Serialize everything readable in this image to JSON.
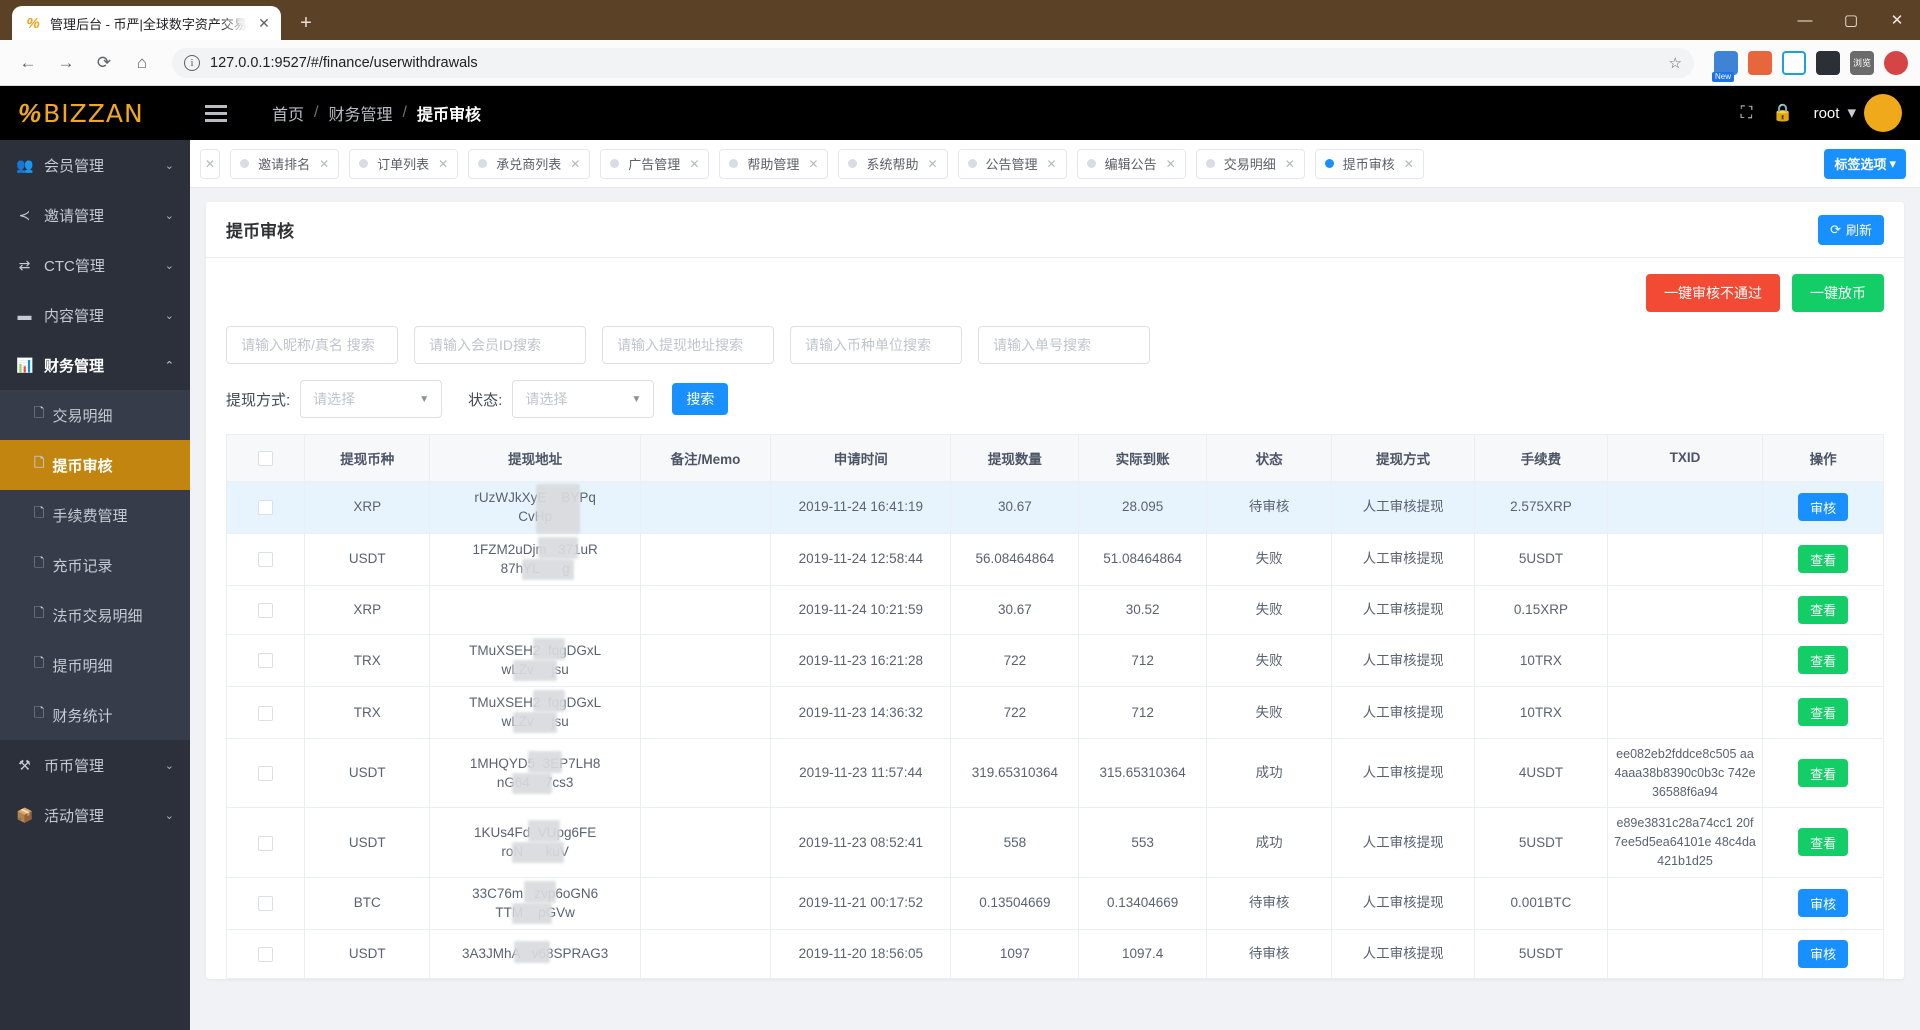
{
  "browser": {
    "tab_title": "管理后台 - 币严|全球数字资产交易",
    "tab_close": "✕",
    "new_tab": "+",
    "back": "←",
    "forward": "→",
    "reload": "⟳",
    "home": "⌂",
    "url": "127.0.0.1:9527/#/finance/userwithdrawals",
    "info_icon": "i",
    "star": "☆",
    "ext_new_badge": "New",
    "ext_labels": [
      "",
      "",
      "",
      "",
      "浏览",
      ""
    ],
    "minimize": "—",
    "maximize": "▢",
    "close": "✕"
  },
  "topbar": {
    "logo_mark": "%",
    "logo_text": "BIZZAN",
    "breadcrumbs": [
      "首页",
      "财务管理",
      "提币审核"
    ],
    "separator": "/",
    "fullscreen_icon": "⛶",
    "lock_icon": "🔒",
    "user_name": "root",
    "user_caret": "▾"
  },
  "sidebar": {
    "items": [
      {
        "label": "会员管理",
        "icon": "👥",
        "arrow": "⌄",
        "open": false
      },
      {
        "label": "邀请管理",
        "icon": "≺",
        "arrow": "⌄",
        "open": false
      },
      {
        "label": "CTC管理",
        "icon": "⇄",
        "arrow": "⌄",
        "open": false
      },
      {
        "label": "内容管理",
        "icon": "▬",
        "arrow": "⌄",
        "open": false
      },
      {
        "label": "财务管理",
        "icon": "📊",
        "arrow": "⌃",
        "open": true
      },
      {
        "label": "币币管理",
        "icon": "⚒",
        "arrow": "⌄",
        "open": false
      },
      {
        "label": "活动管理",
        "icon": "📦",
        "arrow": "⌄",
        "open": false
      }
    ],
    "submenu": [
      {
        "label": "交易明细",
        "icon": "🗋",
        "active": false
      },
      {
        "label": "提币审核",
        "icon": "🗋",
        "active": true
      },
      {
        "label": "手续费管理",
        "icon": "🗋",
        "active": false
      },
      {
        "label": "充币记录",
        "icon": "🗋",
        "active": false
      },
      {
        "label": "法币交易明细",
        "icon": "🗋",
        "active": false
      },
      {
        "label": "提币明细",
        "icon": "🗋",
        "active": false
      },
      {
        "label": "财务统计",
        "icon": "🗋",
        "active": false
      }
    ]
  },
  "tagbar": {
    "tags": [
      {
        "label": "邀请排名",
        "active": false
      },
      {
        "label": "订单列表",
        "active": false
      },
      {
        "label": "承兑商列表",
        "active": false
      },
      {
        "label": "广告管理",
        "active": false
      },
      {
        "label": "帮助管理",
        "active": false
      },
      {
        "label": "系统帮助",
        "active": false
      },
      {
        "label": "公告管理",
        "active": false
      },
      {
        "label": "编辑公告",
        "active": false
      },
      {
        "label": "交易明细",
        "active": false
      },
      {
        "label": "提币审核",
        "active": true
      }
    ],
    "close_glyph": "✕",
    "options_label": "标签选项",
    "options_caret": "▾"
  },
  "page": {
    "title": "提币审核",
    "refresh_label": "刷新",
    "refresh_icon": "⟳",
    "bulk_reject_label": "一键审核不通过",
    "bulk_release_label": "一键放币",
    "filters": [
      {
        "placeholder": "请输入昵称/真名 搜索",
        "value": ""
      },
      {
        "placeholder": "请输入会员ID搜索",
        "value": ""
      },
      {
        "placeholder": "请输入提现地址搜索",
        "value": ""
      },
      {
        "placeholder": "请输入币种单位搜索",
        "value": ""
      },
      {
        "placeholder": "请输入单号搜索",
        "value": ""
      }
    ],
    "selects": [
      {
        "label": "提现方式:",
        "value": "请选择",
        "caret": "▼"
      },
      {
        "label": "状态:",
        "value": "请选择",
        "caret": "▼"
      }
    ],
    "search_label": "搜索"
  },
  "table": {
    "columns": [
      "",
      "提现币种",
      "提现地址",
      "备注/Memo",
      "申请时间",
      "提现数量",
      "实际到账",
      "状态",
      "提现方式",
      "手续费",
      "TXID",
      "操作"
    ],
    "rows": [
      {
        "coin": "XRP",
        "address_1": "rUzWJkXyE",
        "address_2": "BYPq",
        "address_3": "CvHp",
        "memo": "",
        "time": "2019-11-24 16:41:19",
        "amount": "30.67",
        "actual": "28.095",
        "status": "待审核",
        "method": "人工审核提现",
        "fee": "2.575XRP",
        "txid": "",
        "action": "审核",
        "action_type": "approve",
        "highlight": true
      },
      {
        "coin": "USDT",
        "address_1": "1FZM2uDjm",
        "address_2": "371uR",
        "address_3": "87hYL",
        "address_4": "g",
        "memo": "",
        "time": "2019-11-24 12:58:44",
        "amount": "56.08464864",
        "actual": "51.08464864",
        "status": "失败",
        "method": "人工审核提现",
        "fee": "5USDT",
        "txid": "",
        "action": "查看",
        "action_type": "view",
        "highlight": false
      },
      {
        "coin": "XRP",
        "address_1": "",
        "address_2": "",
        "address_3": "",
        "memo": "",
        "time": "2019-11-24 10:21:59",
        "amount": "30.67",
        "actual": "30.52",
        "status": "失败",
        "method": "人工审核提现",
        "fee": "0.15XRP",
        "txid": "",
        "action": "查看",
        "action_type": "view",
        "highlight": false
      },
      {
        "coin": "TRX",
        "address_1": "TMuXSEH2",
        "address_2": "fqgDGxL",
        "address_3": "wLZv",
        "address_4": "jsu",
        "memo": "",
        "time": "2019-11-23 16:21:28",
        "amount": "722",
        "actual": "712",
        "status": "失败",
        "method": "人工审核提现",
        "fee": "10TRX",
        "txid": "",
        "action": "查看",
        "action_type": "view",
        "highlight": false
      },
      {
        "coin": "TRX",
        "address_1": "TMuXSEH2",
        "address_2": "fqgDGxL",
        "address_3": "wLZv",
        "address_4": "jsu",
        "memo": "",
        "time": "2019-11-23 14:36:32",
        "amount": "722",
        "actual": "712",
        "status": "失败",
        "method": "人工审核提现",
        "fee": "10TRX",
        "txid": "",
        "action": "查看",
        "action_type": "view",
        "highlight": false
      },
      {
        "coin": "USDT",
        "address_1": "1MHQYD5",
        "address_2": "3EP7LH8",
        "address_3": "nG64",
        "address_4": "7cs3",
        "memo": "",
        "time": "2019-11-23 11:57:44",
        "amount": "319.65310364",
        "actual": "315.65310364",
        "status": "成功",
        "method": "人工审核提现",
        "fee": "4USDT",
        "txid": "ee082eb2fddce8c505 aa4aaa38b8390c0b3c 742e36588f6a94",
        "action": "查看",
        "action_type": "view",
        "highlight": false
      },
      {
        "coin": "USDT",
        "address_1": "1KUs4Fd",
        "address_2": "VUpg6FE",
        "address_3": "roN",
        "address_4": "kuV",
        "memo": "",
        "time": "2019-11-23 08:52:41",
        "amount": "558",
        "actual": "553",
        "status": "成功",
        "method": "人工审核提现",
        "fee": "5USDT",
        "txid": "e89e3831c28a74cc1 20f7ee5d5ea64101e 48c4da421b1d25",
        "action": "查看",
        "action_type": "view",
        "highlight": false
      },
      {
        "coin": "BTC",
        "address_1": "33C76m",
        "address_2": "zvp6oGN6",
        "address_3": "TTM",
        "address_4": "pGVw",
        "memo": "",
        "time": "2019-11-21 00:17:52",
        "amount": "0.13504669",
        "actual": "0.13404669",
        "status": "待审核",
        "method": "人工审核提现",
        "fee": "0.001BTC",
        "txid": "",
        "action": "审核",
        "action_type": "approve",
        "highlight": false
      },
      {
        "coin": "USDT",
        "address_1": "3A3JMhA",
        "address_2": "v68SPRAG3",
        "address_3": "",
        "address_4": "",
        "memo": "",
        "time": "2019-11-20 18:56:05",
        "amount": "1097",
        "actual": "1097.4",
        "status": "待审核",
        "method": "人工审核提现",
        "fee": "5USDT",
        "txid": "",
        "action": "审核",
        "action_type": "approve",
        "highlight": false
      }
    ]
  }
}
